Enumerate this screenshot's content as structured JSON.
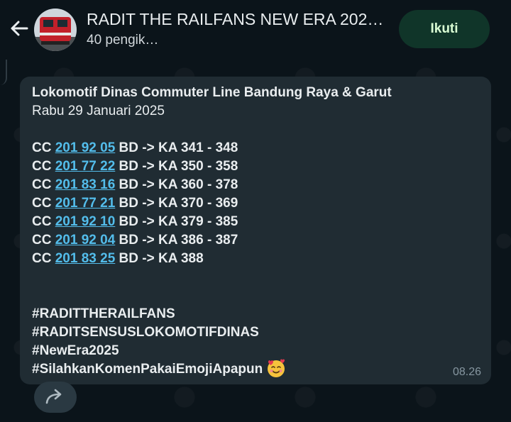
{
  "header": {
    "title": "RADIT THE RAILFANS NEW ERA 202…",
    "subtitle": "40 pengik…",
    "follow_label": "Ikuti",
    "back_icon": "arrow-left-icon",
    "avatar_icon": "locomotive-avatar"
  },
  "message": {
    "heading": "Lokomotif Dinas Commuter Line Bandung Raya & Garut",
    "date": "Rabu 29 Januari 2025",
    "rows": [
      {
        "prefix": "CC",
        "number": "201 92 05",
        "route": "BD -> KA 341 - 348"
      },
      {
        "prefix": "CC",
        "number": "201 77 22",
        "route": "BD -> KA 350 - 358"
      },
      {
        "prefix": "CC",
        "number": "201 83 16",
        "route": "BD -> KA 360 - 378"
      },
      {
        "prefix": "CC",
        "number": "201 77 21",
        "route": "BD -> KA 370 - 369"
      },
      {
        "prefix": "CC",
        "number": "201 92 10",
        "route": "BD -> KA 379 - 385"
      },
      {
        "prefix": "CC",
        "number": "201 92 04",
        "route": "BD -> KA 386 - 387"
      },
      {
        "prefix": "CC",
        "number": "201 83 25",
        "route": "BD -> KA 388"
      }
    ],
    "hashtags": [
      "#RADITTHERAILFANS",
      "#RADITSENSUSLOKOMOTIFDINAS",
      "#NewEra2025",
      "#SilahkanKomenPakaiEmojiApapun"
    ],
    "emoji_icon": "smiling-face-with-hearts-emoji",
    "time": "08.26"
  },
  "forward_icon": "forward-arrow-icon",
  "colors": {
    "background": "#0b141a",
    "bubble": "#202c33",
    "link": "#53bdeb",
    "follow_button": "#103529",
    "follow_text": "#d9fdd3"
  }
}
